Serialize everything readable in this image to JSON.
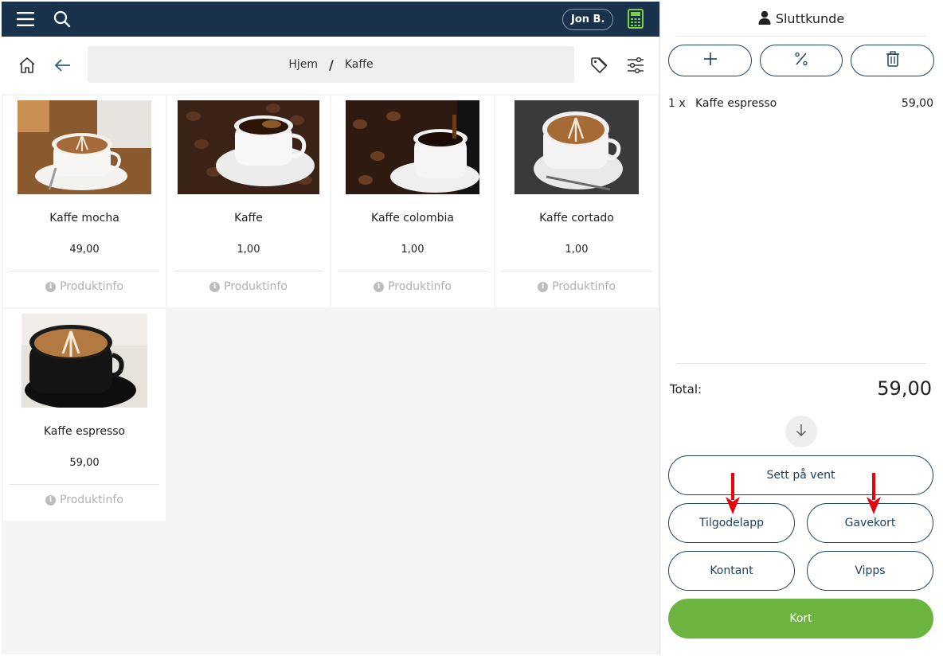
{
  "header": {
    "user_name": "Jon B.",
    "menu_icon": "hamburger-menu-icon",
    "search_icon": "search-icon",
    "calculator_icon": "calculator-icon"
  },
  "nav": {
    "home_icon": "home-icon",
    "back_icon": "back-arrow-icon",
    "breadcrumb": [
      "Hjem",
      "Kaffe"
    ],
    "breadcrumb_separator": "/",
    "tag_icon": "tag-icon",
    "filter_icon": "filter-sliders-icon"
  },
  "products": [
    {
      "name": "Kaffe mocha",
      "price": "49,00",
      "info": "Produktinfo"
    },
    {
      "name": "Kaffe",
      "price": "1,00",
      "info": "Produktinfo"
    },
    {
      "name": "Kaffe colombia",
      "price": "1,00",
      "info": "Produktinfo"
    },
    {
      "name": "Kaffe cortado",
      "price": "1,00",
      "info": "Produktinfo"
    },
    {
      "name": "Kaffe espresso",
      "price": "59,00",
      "info": "Produktinfo"
    }
  ],
  "cart": {
    "customer": "Sluttkunde",
    "actions": {
      "add_icon": "plus-icon",
      "discount_icon": "percent-icon",
      "delete_icon": "trash-icon"
    },
    "items": [
      {
        "qty": "1 x",
        "name": "Kaffe espresso",
        "price": "59,00"
      }
    ],
    "total_label": "Total:",
    "total_value": "59,00",
    "buttons": {
      "hold": "Sett på vent",
      "credit_note": "Tilgodelapp",
      "gift_card": "Gavekort",
      "cash": "Kontant",
      "vipps": "Vipps",
      "card": "Kort"
    }
  },
  "colors": {
    "topbar": "#17324a",
    "accent_green": "#6db33f",
    "button_outline": "#1e4160",
    "annotation_arrow": "#e8000b"
  }
}
